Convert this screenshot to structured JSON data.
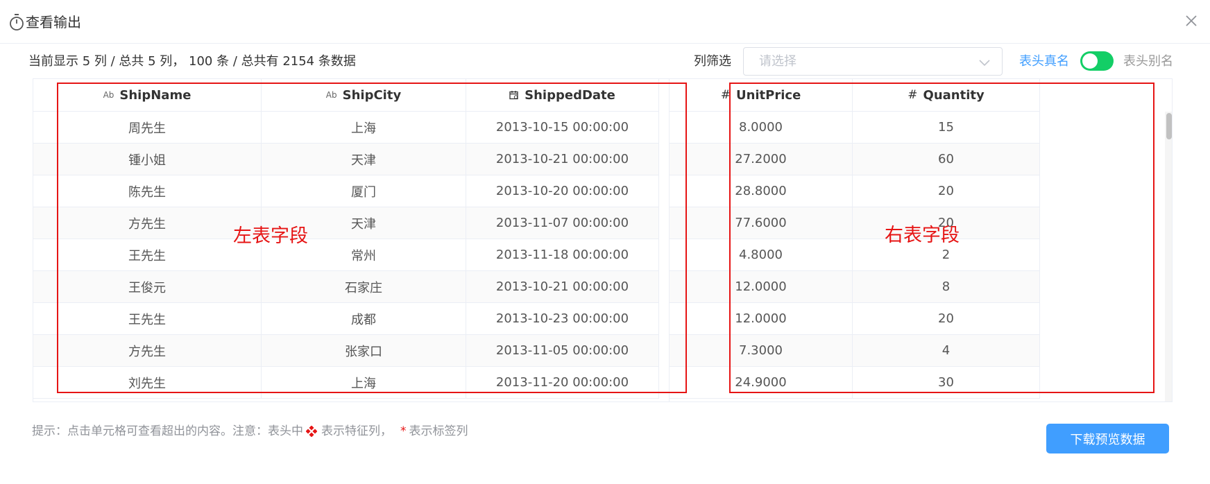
{
  "dialog": {
    "title": "查看输出",
    "close_icon": "close-icon"
  },
  "toolbar": {
    "summary": "当前显示 5 列 / 总共 5 列， 100 条 / 总共有 2154 条数据",
    "filter_label": "列筛选",
    "filter_placeholder": "请选择",
    "toggle_left_label": "表头真名",
    "toggle_right_label": "表头别名",
    "toggle_on": true
  },
  "table": {
    "columns": [
      {
        "name": "ShipName",
        "type_icon": "Ab",
        "type": "text"
      },
      {
        "name": "ShipCity",
        "type_icon": "Ab",
        "type": "text"
      },
      {
        "name": "ShippedDate",
        "type_icon": "calendar-icon",
        "type": "date"
      },
      {
        "name": "UnitPrice",
        "type_icon": "#",
        "type": "number"
      },
      {
        "name": "Quantity",
        "type_icon": "#",
        "type": "number"
      }
    ],
    "rows": [
      [
        "周先生",
        "上海",
        "2013-10-15 00:00:00",
        "8.0000",
        "15"
      ],
      [
        "锺小姐",
        "天津",
        "2013-10-21 00:00:00",
        "27.2000",
        "60"
      ],
      [
        "陈先生",
        "厦门",
        "2013-10-20 00:00:00",
        "28.8000",
        "20"
      ],
      [
        "方先生",
        "天津",
        "2013-11-07 00:00:00",
        "77.6000",
        "20"
      ],
      [
        "王先生",
        "常州",
        "2013-11-18 00:00:00",
        "4.8000",
        "2"
      ],
      [
        "王俊元",
        "石家庄",
        "2013-10-21 00:00:00",
        "12.0000",
        "8"
      ],
      [
        "王先生",
        "成都",
        "2013-10-23 00:00:00",
        "12.0000",
        "20"
      ],
      [
        "方先生",
        "张家口",
        "2013-11-05 00:00:00",
        "7.3000",
        "4"
      ],
      [
        "刘先生",
        "上海",
        "2013-11-20 00:00:00",
        "24.9000",
        "30"
      ]
    ]
  },
  "annotations": {
    "left_label": "左表字段",
    "right_label": "右表字段",
    "color": "#e61414"
  },
  "footer": {
    "tip_prefix": "提示：点击单元格可查看超出的内容。注意：表头中",
    "tip_feature": "表示特征列，",
    "tip_star": "*",
    "tip_label": "表示标签列",
    "download_label": "下载预览数据"
  },
  "colors": {
    "accent": "#409eff",
    "toggle": "#13ce66",
    "annotation": "#e61414"
  }
}
